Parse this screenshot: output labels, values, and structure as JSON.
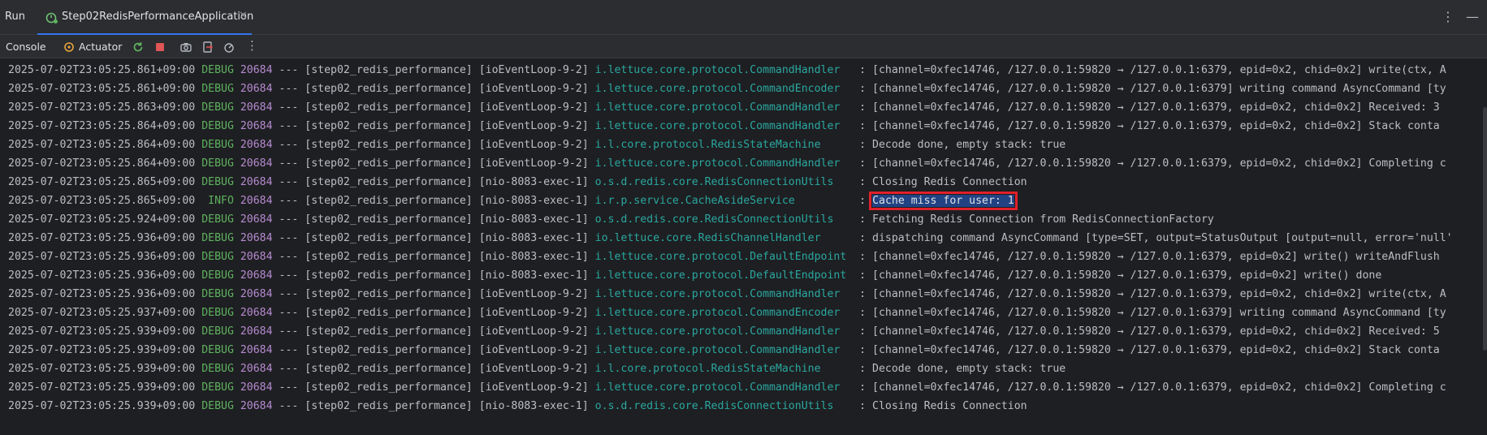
{
  "topbar": {
    "run_label": "Run",
    "tab_label": "Step02RedisPerformanceApplication",
    "tab_close": "✕",
    "more": "⋮",
    "minimize": "—"
  },
  "toolbar": {
    "console_label": "Console",
    "actuator_label": "Actuator",
    "more": "⋮"
  },
  "log_lines": [
    {
      "ts": "2025-07-02T23:05:25.861+09:00",
      "level": "DEBUG",
      "pid": "20684",
      "sep": "---",
      "app": "[step02_redis_performance]",
      "thread": "[ioEventLoop-9-2]",
      "logger": "i.lettuce.core.protocol.CommandHandler  ",
      "msg": ": [channel=0xfec14746, /127.0.0.1:59820 → /127.0.0.1:6379, epid=0x2, chid=0x2] write(ctx, A"
    },
    {
      "ts": "2025-07-02T23:05:25.861+09:00",
      "level": "DEBUG",
      "pid": "20684",
      "sep": "---",
      "app": "[step02_redis_performance]",
      "thread": "[ioEventLoop-9-2]",
      "logger": "i.lettuce.core.protocol.CommandEncoder  ",
      "msg": ": [channel=0xfec14746, /127.0.0.1:59820 → /127.0.0.1:6379] writing command AsyncCommand [ty"
    },
    {
      "ts": "2025-07-02T23:05:25.863+09:00",
      "level": "DEBUG",
      "pid": "20684",
      "sep": "---",
      "app": "[step02_redis_performance]",
      "thread": "[ioEventLoop-9-2]",
      "logger": "i.lettuce.core.protocol.CommandHandler  ",
      "msg": ": [channel=0xfec14746, /127.0.0.1:59820 → /127.0.0.1:6379, epid=0x2, chid=0x2] Received: 3"
    },
    {
      "ts": "2025-07-02T23:05:25.864+09:00",
      "level": "DEBUG",
      "pid": "20684",
      "sep": "---",
      "app": "[step02_redis_performance]",
      "thread": "[ioEventLoop-9-2]",
      "logger": "i.lettuce.core.protocol.CommandHandler  ",
      "msg": ": [channel=0xfec14746, /127.0.0.1:59820 → /127.0.0.1:6379, epid=0x2, chid=0x2] Stack conta"
    },
    {
      "ts": "2025-07-02T23:05:25.864+09:00",
      "level": "DEBUG",
      "pid": "20684",
      "sep": "---",
      "app": "[step02_redis_performance]",
      "thread": "[ioEventLoop-9-2]",
      "logger": "i.l.core.protocol.RedisStateMachine     ",
      "msg": ": Decode done, empty stack: true"
    },
    {
      "ts": "2025-07-02T23:05:25.864+09:00",
      "level": "DEBUG",
      "pid": "20684",
      "sep": "---",
      "app": "[step02_redis_performance]",
      "thread": "[ioEventLoop-9-2]",
      "logger": "i.lettuce.core.protocol.CommandHandler  ",
      "msg": ": [channel=0xfec14746, /127.0.0.1:59820 → /127.0.0.1:6379, epid=0x2, chid=0x2] Completing c"
    },
    {
      "ts": "2025-07-02T23:05:25.865+09:00",
      "level": "DEBUG",
      "pid": "20684",
      "sep": "---",
      "app": "[step02_redis_performance]",
      "thread": "[nio-8083-exec-1]",
      "logger": "o.s.d.redis.core.RedisConnectionUtils   ",
      "msg": ": Closing Redis Connection"
    },
    {
      "ts": "2025-07-02T23:05:25.865+09:00",
      "level": " INFO",
      "pid": "20684",
      "sep": "---",
      "app": "[step02_redis_performance]",
      "thread": "[nio-8083-exec-1]",
      "logger": "i.r.p.service.CacheAsideService         ",
      "msg": ": ",
      "highlight": "Cache miss for user: 1"
    },
    {
      "ts": "2025-07-02T23:05:25.924+09:00",
      "level": "DEBUG",
      "pid": "20684",
      "sep": "---",
      "app": "[step02_redis_performance]",
      "thread": "[nio-8083-exec-1]",
      "logger": "o.s.d.redis.core.RedisConnectionUtils   ",
      "msg": ": Fetching Redis Connection from RedisConnectionFactory"
    },
    {
      "ts": "2025-07-02T23:05:25.936+09:00",
      "level": "DEBUG",
      "pid": "20684",
      "sep": "---",
      "app": "[step02_redis_performance]",
      "thread": "[nio-8083-exec-1]",
      "logger": "io.lettuce.core.RedisChannelHandler     ",
      "msg": ": dispatching command AsyncCommand [type=SET, output=StatusOutput [output=null, error='null'"
    },
    {
      "ts": "2025-07-02T23:05:25.936+09:00",
      "level": "DEBUG",
      "pid": "20684",
      "sep": "---",
      "app": "[step02_redis_performance]",
      "thread": "[nio-8083-exec-1]",
      "logger": "i.lettuce.core.protocol.DefaultEndpoint ",
      "msg": ": [channel=0xfec14746, /127.0.0.1:59820 → /127.0.0.1:6379, epid=0x2] write() writeAndFlush"
    },
    {
      "ts": "2025-07-02T23:05:25.936+09:00",
      "level": "DEBUG",
      "pid": "20684",
      "sep": "---",
      "app": "[step02_redis_performance]",
      "thread": "[nio-8083-exec-1]",
      "logger": "i.lettuce.core.protocol.DefaultEndpoint ",
      "msg": ": [channel=0xfec14746, /127.0.0.1:59820 → /127.0.0.1:6379, epid=0x2] write() done"
    },
    {
      "ts": "2025-07-02T23:05:25.936+09:00",
      "level": "DEBUG",
      "pid": "20684",
      "sep": "---",
      "app": "[step02_redis_performance]",
      "thread": "[ioEventLoop-9-2]",
      "logger": "i.lettuce.core.protocol.CommandHandler  ",
      "msg": ": [channel=0xfec14746, /127.0.0.1:59820 → /127.0.0.1:6379, epid=0x2, chid=0x2] write(ctx, A"
    },
    {
      "ts": "2025-07-02T23:05:25.937+09:00",
      "level": "DEBUG",
      "pid": "20684",
      "sep": "---",
      "app": "[step02_redis_performance]",
      "thread": "[ioEventLoop-9-2]",
      "logger": "i.lettuce.core.protocol.CommandEncoder  ",
      "msg": ": [channel=0xfec14746, /127.0.0.1:59820 → /127.0.0.1:6379] writing command AsyncCommand [ty"
    },
    {
      "ts": "2025-07-02T23:05:25.939+09:00",
      "level": "DEBUG",
      "pid": "20684",
      "sep": "---",
      "app": "[step02_redis_performance]",
      "thread": "[ioEventLoop-9-2]",
      "logger": "i.lettuce.core.protocol.CommandHandler  ",
      "msg": ": [channel=0xfec14746, /127.0.0.1:59820 → /127.0.0.1:6379, epid=0x2, chid=0x2] Received: 5"
    },
    {
      "ts": "2025-07-02T23:05:25.939+09:00",
      "level": "DEBUG",
      "pid": "20684",
      "sep": "---",
      "app": "[step02_redis_performance]",
      "thread": "[ioEventLoop-9-2]",
      "logger": "i.lettuce.core.protocol.CommandHandler  ",
      "msg": ": [channel=0xfec14746, /127.0.0.1:59820 → /127.0.0.1:6379, epid=0x2, chid=0x2] Stack conta"
    },
    {
      "ts": "2025-07-02T23:05:25.939+09:00",
      "level": "DEBUG",
      "pid": "20684",
      "sep": "---",
      "app": "[step02_redis_performance]",
      "thread": "[ioEventLoop-9-2]",
      "logger": "i.l.core.protocol.RedisStateMachine     ",
      "msg": ": Decode done, empty stack: true"
    },
    {
      "ts": "2025-07-02T23:05:25.939+09:00",
      "level": "DEBUG",
      "pid": "20684",
      "sep": "---",
      "app": "[step02_redis_performance]",
      "thread": "[ioEventLoop-9-2]",
      "logger": "i.lettuce.core.protocol.CommandHandler  ",
      "msg": ": [channel=0xfec14746, /127.0.0.1:59820 → /127.0.0.1:6379, epid=0x2, chid=0x2] Completing c"
    },
    {
      "ts": "2025-07-02T23:05:25.939+09:00",
      "level": "DEBUG",
      "pid": "20684",
      "sep": "---",
      "app": "[step02_redis_performance]",
      "thread": "[nio-8083-exec-1]",
      "logger": "o.s.d.redis.core.RedisConnectionUtils   ",
      "msg": ": Closing Redis Connection"
    }
  ]
}
